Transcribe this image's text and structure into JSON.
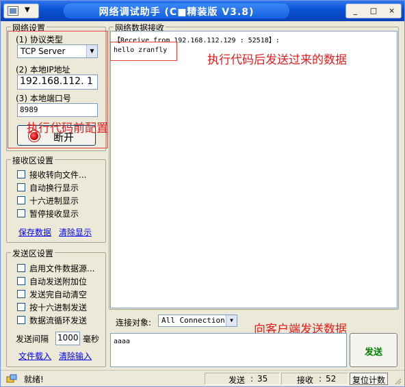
{
  "window": {
    "title": "网络调试助手 (C■精装版 V3.8)",
    "controls": {
      "minimize": "_",
      "maximize": "□",
      "close": "×"
    },
    "sysmenu_arrow": "▼"
  },
  "network_settings": {
    "group_label": "网络设置",
    "protocol_label": "(1) 协议类型",
    "protocol_value": "TCP Server",
    "ip_label": "(2) 本地IP地址",
    "ip_value": "192.168.112. 1",
    "port_label": "(3) 本地端口号",
    "port_value": "8989",
    "disconnect_label": "断开"
  },
  "receive_settings": {
    "group_label": "接收区设置",
    "options": [
      "接收转向文件...",
      "自动换行显示",
      "十六进制显示",
      "暂停接收显示"
    ],
    "save_link": "保存数据",
    "clear_link": "清除显示"
  },
  "send_settings": {
    "group_label": "发送区设置",
    "options": [
      "启用文件数据源...",
      "自动发送附加位",
      "发送完自动清空",
      "按十六进制发送",
      "数据流循环发送"
    ],
    "interval_label": "发送间隔",
    "interval_value": "1000",
    "interval_unit": "毫秒",
    "load_link": "文件载入",
    "clear_link": "清除输入"
  },
  "receive_area": {
    "group_label": "网络数据接收",
    "header_line": "【Receive from 192.168.112.129 : 52518】:",
    "data_line": "hello zranfly"
  },
  "connect": {
    "label": "连接对象:",
    "value": "All Connections"
  },
  "send_area": {
    "text": "aaaa",
    "send_button": "发送"
  },
  "status_bar": {
    "ready": "就绪!",
    "sent_label": "发送",
    "sent_value": "35",
    "recv_label": "接收",
    "recv_value": "52",
    "reset_button": "复位计数"
  },
  "annotations": {
    "before_config": "执行代码前配置",
    "after_receive": "执行代码后发送过来的数据",
    "send_to_client": "向客户端发送数据"
  },
  "colors": {
    "annotation": "#e0201e",
    "title_bar": "#0a52d4",
    "send_button_text": "#008000"
  }
}
